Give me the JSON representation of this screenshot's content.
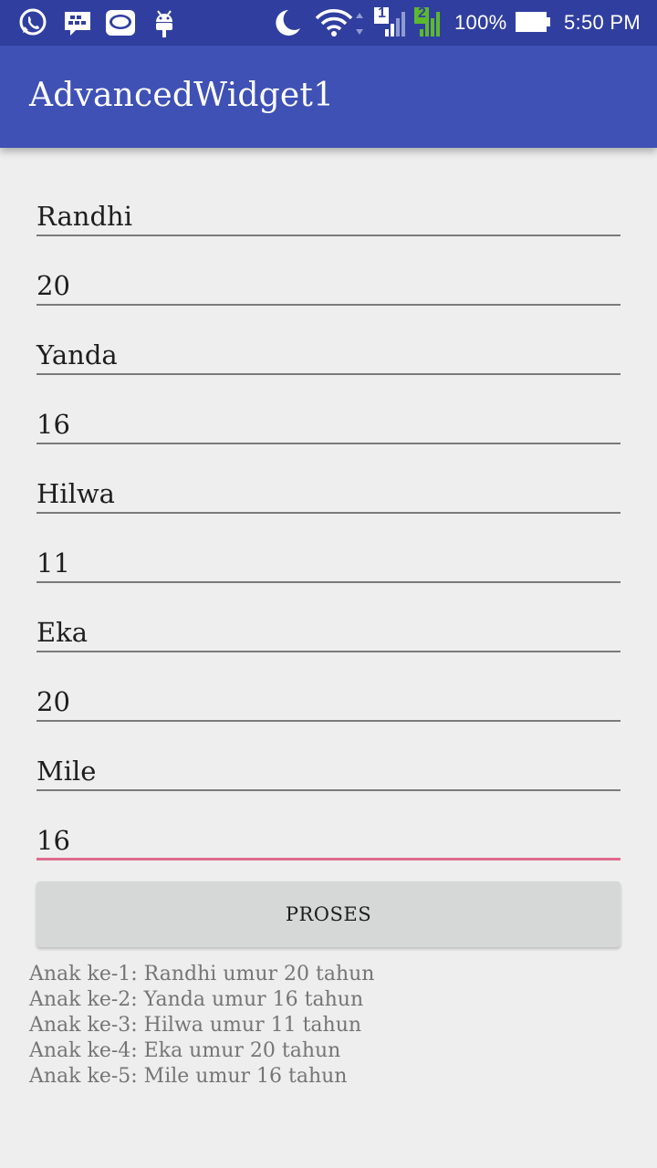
{
  "status_bar": {
    "icons": [
      "whatsapp-icon",
      "bbm-icon",
      "line-icon",
      "android-icon",
      "moon-icon",
      "wifi-icon",
      "sim1-signal-icon",
      "sim2-signal-icon",
      "battery-icon"
    ],
    "sim1_label": "1",
    "sim2_label": "2",
    "battery": "100%",
    "time": "5:50 PM"
  },
  "app_bar": {
    "title": "AdvancedWidget1"
  },
  "form": {
    "fields": [
      {
        "value": "Randhi"
      },
      {
        "value": "20"
      },
      {
        "value": "Yanda"
      },
      {
        "value": "16"
      },
      {
        "value": "Hilwa"
      },
      {
        "value": "11"
      },
      {
        "value": "Eka"
      },
      {
        "value": "20"
      },
      {
        "value": "Mile"
      },
      {
        "value": "16"
      }
    ],
    "button_label": "PROSES"
  },
  "results": [
    "Anak ke-1: Randhi umur 20 tahun",
    "Anak ke-2: Yanda umur 16 tahun",
    "Anak ke-3: Hilwa umur 11 tahun",
    "Anak ke-4: Eka umur 20 tahun",
    "Anak ke-5: Mile umur 16 tahun"
  ],
  "colors": {
    "status_bar": "#303f9f",
    "app_bar": "#3f51b5",
    "accent": "#e06b8e",
    "sim2_signal": "#5cb82e"
  }
}
